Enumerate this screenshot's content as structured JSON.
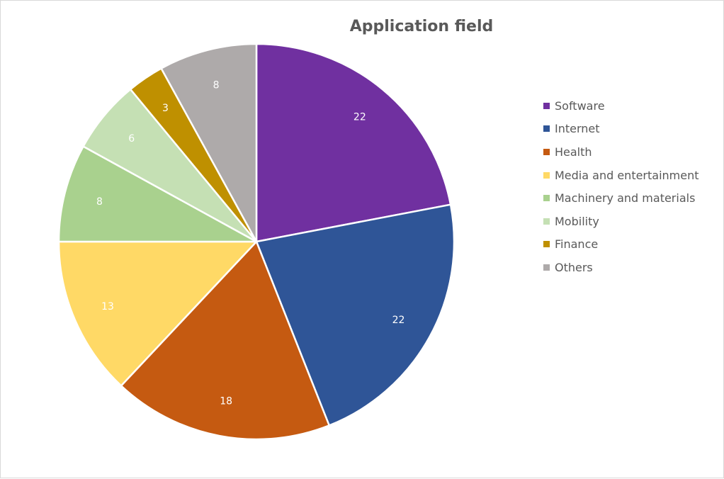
{
  "chart_data": {
    "type": "pie",
    "title": "Application field",
    "categories": [
      "Software",
      "Internet",
      "Health",
      "Media and entertainment",
      "Machinery and materials",
      "Mobility",
      "Finance",
      "Others"
    ],
    "values": [
      22,
      22,
      18,
      13,
      8,
      6,
      3,
      8
    ],
    "colors": [
      "#7030a0",
      "#2f5597",
      "#c55a11",
      "#ffd966",
      "#a9d18e",
      "#c5e0b4",
      "#bf9000",
      "#aeaaaa"
    ],
    "data_labels": [
      "22",
      "22",
      "18",
      "13",
      "8",
      "6",
      "3",
      "8"
    ],
    "start_angle": "12 o'clock",
    "direction": "clockwise",
    "legend_position": "right"
  }
}
